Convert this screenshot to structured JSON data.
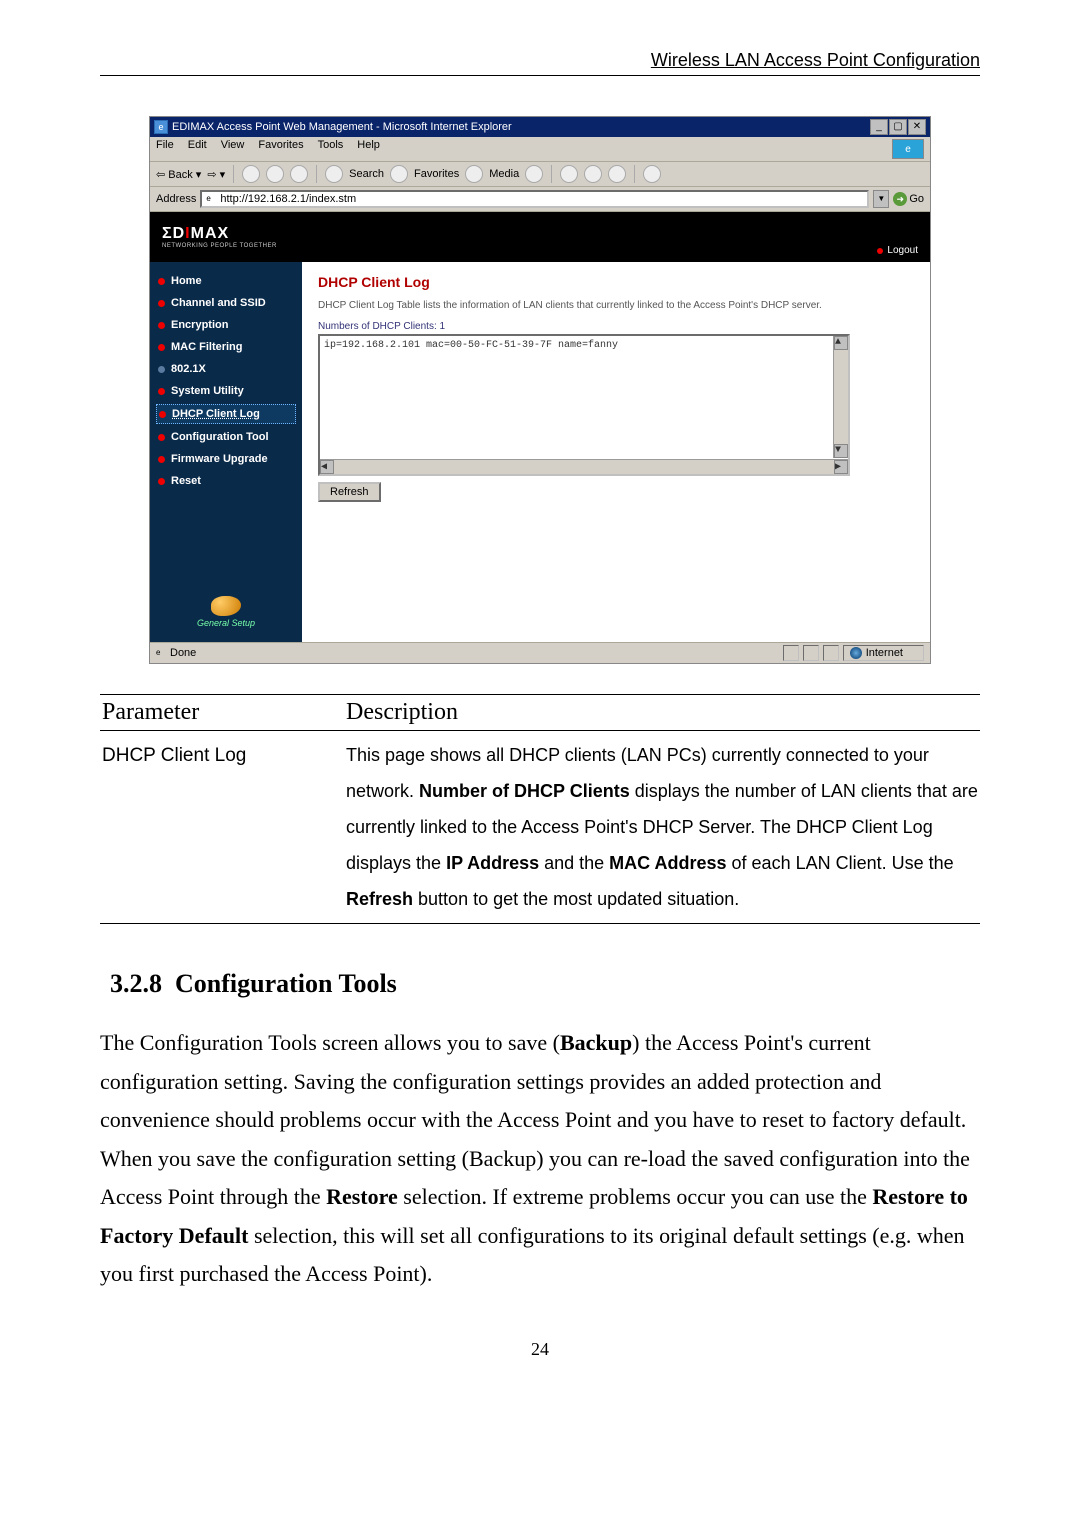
{
  "header": "Wireless LAN Access Point Configuration",
  "screenshot": {
    "title": "EDIMAX Access Point Web Management - Microsoft Internet Explorer",
    "menus": [
      "File",
      "Edit",
      "View",
      "Favorites",
      "Tools",
      "Help"
    ],
    "toolbar": {
      "back": "Back",
      "search": "Search",
      "favorites": "Favorites",
      "media": "Media"
    },
    "address_label": "Address",
    "address_url": "http://192.168.2.1/index.stm",
    "go": "Go",
    "logo_main": "ΣDIMAX",
    "logo_sub": "NETWORKING PEOPLE TOGETHER",
    "logout": "Logout",
    "nav": [
      {
        "label": "Home",
        "active": false,
        "bullet": "red"
      },
      {
        "label": "Channel and SSID",
        "active": false,
        "bullet": "red"
      },
      {
        "label": "Encryption",
        "active": false,
        "bullet": "red"
      },
      {
        "label": "MAC Filtering",
        "active": false,
        "bullet": "red"
      },
      {
        "label": "802.1X",
        "active": false,
        "bullet": "muted"
      },
      {
        "label": "System Utility",
        "active": false,
        "bullet": "red"
      },
      {
        "label": "DHCP Client Log",
        "active": true,
        "bullet": "red"
      },
      {
        "label": "Configuration Tool",
        "active": false,
        "bullet": "red"
      },
      {
        "label": "Firmware Upgrade",
        "active": false,
        "bullet": "red"
      },
      {
        "label": "Reset",
        "active": false,
        "bullet": "red"
      }
    ],
    "general_setup": "General Setup",
    "content": {
      "title": "DHCP Client Log",
      "desc": "DHCP Client Log Table lists the information of LAN clients that currently linked to the Access Point's DHCP server.",
      "count_label": "Numbers of DHCP Clients: 1",
      "log_line": "ip=192.168.2.101   mac=00-50-FC-51-39-7F    name=fanny",
      "refresh": "Refresh"
    },
    "status_done": "Done",
    "status_zone": "Internet"
  },
  "table": {
    "head_param": "Parameter",
    "head_desc": "Description",
    "param1": "DHCP Client Log",
    "desc1_a": "This page shows all DHCP clients (LAN PCs) currently connected to your network. ",
    "desc1_b": "Number of DHCP Clients",
    "desc1_c": " displays the number of LAN clients that are currently linked to the Access Point's DHCP Server. The DHCP Client Log displays the ",
    "desc1_d": "IP Address",
    "desc1_e": " and the ",
    "desc1_f": "MAC Address",
    "desc1_g": " of each LAN Client. Use the ",
    "desc1_h": "Refresh",
    "desc1_i": " button to get the most updated situation."
  },
  "section": {
    "number": "3.2.8",
    "title": "Configuration Tools",
    "body_a": "The Configuration Tools screen allows you to save (",
    "body_b": "Backup",
    "body_c": ") the Access Point's current configuration setting. Saving the configuration settings provides an added protection and convenience should problems occur with the Access Point and you have to reset to factory default. When you save the configuration setting (Backup) you can re-load the saved configuration into the Access Point through the ",
    "body_d": "Restore",
    "body_e": " selection. If extreme problems occur you can use the ",
    "body_f": "Restore to Factory Default",
    "body_g": " selection, this will set all configurations to its original default settings (e.g. when you first purchased the Access Point)."
  },
  "page_number": "24"
}
